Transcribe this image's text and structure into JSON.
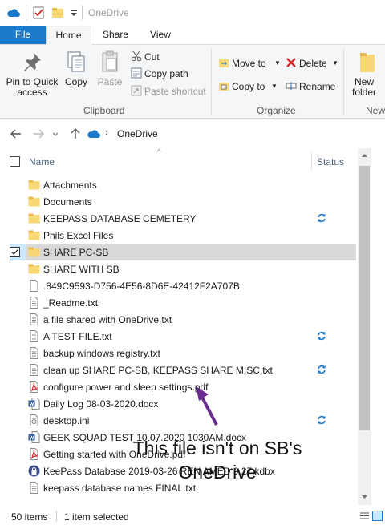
{
  "window": {
    "title": "OneDrive"
  },
  "tabs": [
    {
      "label": "File"
    },
    {
      "label": "Home"
    },
    {
      "label": "Share"
    },
    {
      "label": "View"
    }
  ],
  "ribbon": {
    "clipboard": {
      "pin_label": "Pin to Quick access",
      "copy_label": "Copy",
      "paste_label": "Paste",
      "cut_label": "Cut",
      "copy_path_label": "Copy path",
      "paste_shortcut_label": "Paste shortcut",
      "group_label": "Clipboard"
    },
    "organize": {
      "move_to_label": "Move to",
      "copy_to_label": "Copy to",
      "delete_label": "Delete",
      "rename_label": "Rename",
      "group_label": "Organize"
    },
    "new": {
      "new_folder_label": "New folder",
      "group_label": "New"
    }
  },
  "address": {
    "crumb": "OneDrive"
  },
  "columns": {
    "name": "Name",
    "status": "Status"
  },
  "files": [
    {
      "name": "Attachments",
      "type": "folder",
      "sync": false
    },
    {
      "name": "Documents",
      "type": "folder",
      "sync": false
    },
    {
      "name": "KEEPASS DATABASE CEMETERY",
      "type": "folder",
      "sync": true
    },
    {
      "name": "Phils Excel Files",
      "type": "folder",
      "sync": false
    },
    {
      "name": "SHARE PC-SB",
      "type": "folder",
      "sync": false,
      "selected": true
    },
    {
      "name": "SHARE WITH SB",
      "type": "folder",
      "sync": false
    },
    {
      "name": ".849C9593-D756-4E56-8D6E-42412F2A707B",
      "type": "file",
      "sync": false
    },
    {
      "name": "_Readme.txt",
      "type": "text",
      "sync": false
    },
    {
      "name": "a file shared with OneDrive.txt",
      "type": "text",
      "sync": false
    },
    {
      "name": "A TEST FILE.txt",
      "type": "text",
      "sync": true
    },
    {
      "name": "backup windows registry.txt",
      "type": "text",
      "sync": false
    },
    {
      "name": "clean up SHARE PC-SB, KEEPASS SHARE MISC.txt",
      "type": "text",
      "sync": true
    },
    {
      "name": "configure power and sleep settings.pdf",
      "type": "pdf",
      "sync": false
    },
    {
      "name": "Daily Log 08-03-2020.docx",
      "type": "word",
      "sync": false
    },
    {
      "name": "desktop.ini",
      "type": "ini",
      "sync": true
    },
    {
      "name": "GEEK SQUAD TEST 10.07.2020 1030AM.docx",
      "type": "word",
      "sync": false
    },
    {
      "name": "Getting started with OneDrive.pdf",
      "type": "pdf",
      "sync": false
    },
    {
      "name": "KeePass Database 2019-03-26 REN AMED 9.27.kdbx",
      "type": "keepass",
      "sync": false
    },
    {
      "name": "keepass database names FINAL.txt",
      "type": "text",
      "sync": false
    }
  ],
  "statusbar": {
    "count": "50 items",
    "selection": "1 item selected"
  },
  "annotation": {
    "line1": "This file isn't on SB's",
    "line2": "OneDrive"
  },
  "colors": {
    "accent": "#1979ca",
    "selection": "#d9d9d9",
    "folder": "#f8d775",
    "sync": "#1979ca",
    "arrow": "#6b2c8f",
    "pdf": "#d32f2f",
    "word": "#2b579a"
  }
}
